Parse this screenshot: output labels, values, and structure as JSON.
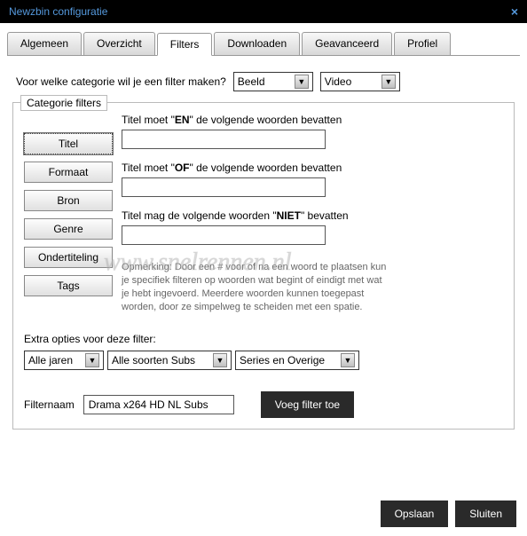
{
  "window": {
    "title": "Newzbin configuratie",
    "close": "×"
  },
  "tabs": [
    "Algemeen",
    "Overzicht",
    "Filters",
    "Downloaden",
    "Geavanceerd",
    "Profiel"
  ],
  "active_tab_index": 2,
  "category_question": "Voor welke categorie wil je een filter maken?",
  "category_select1": "Beeld",
  "category_select2": "Video",
  "fieldset_legend": "Categorie filters",
  "side_buttons": [
    "Titel",
    "Formaat",
    "Bron",
    "Genre",
    "Ondertiteling",
    "Tags"
  ],
  "selected_side_index": 0,
  "label_and_pre": "Titel moet \"",
  "label_and_bold": "EN",
  "label_and_post": "\" de volgende woorden  bevatten",
  "label_or_pre": "Titel moet \"",
  "label_or_bold": "OF",
  "label_or_post": "\" de volgende woorden  bevatten",
  "label_not_pre": "Titel mag de volgende woorden \"",
  "label_not_bold": "NIET",
  "label_not_post": "\" bevatten",
  "input_and": "",
  "input_or": "",
  "input_not": "",
  "note": "Opmerking: Door een # voor of na een woord te plaatsen kun je specifiek filteren op woorden wat begint of eindigt met wat je hebt ingevoerd. Meerdere woorden kunnen toegepast worden, door ze simpelweg te scheiden met een spatie.",
  "extra_label": "Extra opties voor deze filter:",
  "extra1": "Alle jaren",
  "extra2": "Alle soorten Subs",
  "extra3": "Series en Overige",
  "filtername_label": "Filternaam",
  "filtername_value": "Drama x264 HD NL Subs",
  "add_filter_btn": "Voeg filter toe",
  "save_btn": "Opslaan",
  "close_btn": "Sluiten",
  "watermark": "www.snelrennen.nl"
}
